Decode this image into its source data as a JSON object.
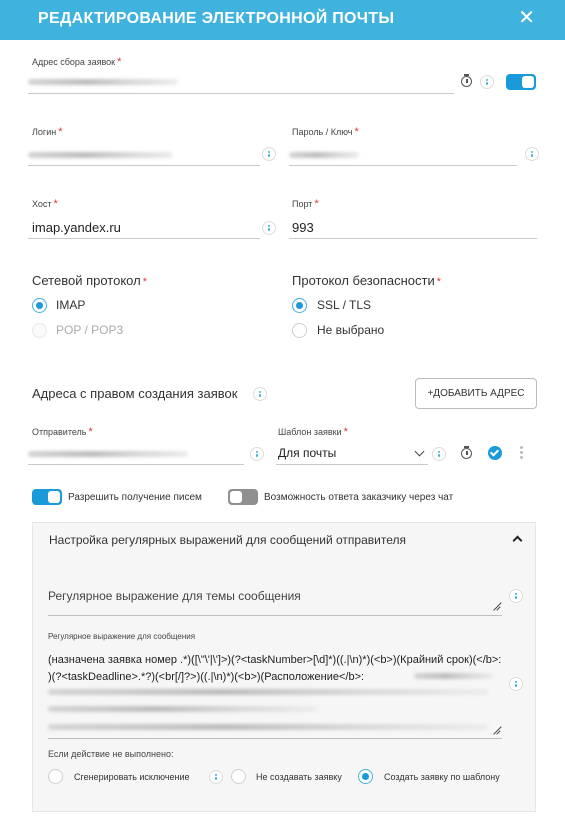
{
  "header": {
    "title": "РЕДАКТИРОВАНИЕ ЭЛЕКТРОННОЙ ПОЧТЫ",
    "close": "✕"
  },
  "collect_address": {
    "label": "Адрес сбора заявок",
    "required": "*"
  },
  "login": {
    "label": "Логин",
    "required": "*"
  },
  "password": {
    "label": "Пароль / Ключ",
    "required": "*"
  },
  "host": {
    "label": "Хост",
    "required": "*",
    "value": "imap.yandex.ru"
  },
  "port": {
    "label": "Порт",
    "required": "*",
    "value": "993"
  },
  "network_protocol": {
    "label": "Сетевой протокол",
    "required": "*",
    "options": [
      {
        "label": "IMAP",
        "selected": true
      },
      {
        "label": "POP / POP3",
        "selected": false,
        "disabled": true
      }
    ]
  },
  "security_protocol": {
    "label": "Протокол безопасности",
    "required": "*",
    "options": [
      {
        "label": "SSL / TLS",
        "selected": true
      },
      {
        "label": "Не выбрано",
        "selected": false
      }
    ]
  },
  "allowed_addresses": {
    "title": "Адреса с правом создания заявок",
    "add_button": "+ДОБАВИТЬ АДРЕС"
  },
  "sender": {
    "label": "Отправитель",
    "required": "*"
  },
  "template": {
    "label": "Шаблон заявки",
    "required": "*",
    "value": "Для почты"
  },
  "toggles": {
    "receive_emails": "Разрешить получение писем",
    "chat_reply": "Возможность ответа заказчику через чат"
  },
  "regex_panel": {
    "title": "Настройка регулярных выражений для сообщений отправителя",
    "subject_placeholder": "Регулярное выражение для темы сообщения",
    "message_label": "Регулярное выражение для сообщения",
    "message_value": "(назначена заявка номер .*)([\\\"\\'|\\']>)(?<taskNumber>[\\d]*)((.|\\n)*)(<b>)(Крайний срок)(</b>: )(?<taskDeadline>.*?)(<br[/]?>)((.|\\n)*)(<b>)(Расположение</b>:",
    "on_fail_label": "Если действие не выполнено:",
    "on_fail_options": [
      {
        "label": "Сгенерировать исключение",
        "selected": false
      },
      {
        "label": "Не создавать заявку",
        "selected": false
      },
      {
        "label": "Создать заявку по шаблону",
        "selected": true
      }
    ]
  },
  "colors": {
    "accent": "#3fb2dd",
    "toggle_on": "#1a9ad8",
    "required": "#e0333a"
  }
}
